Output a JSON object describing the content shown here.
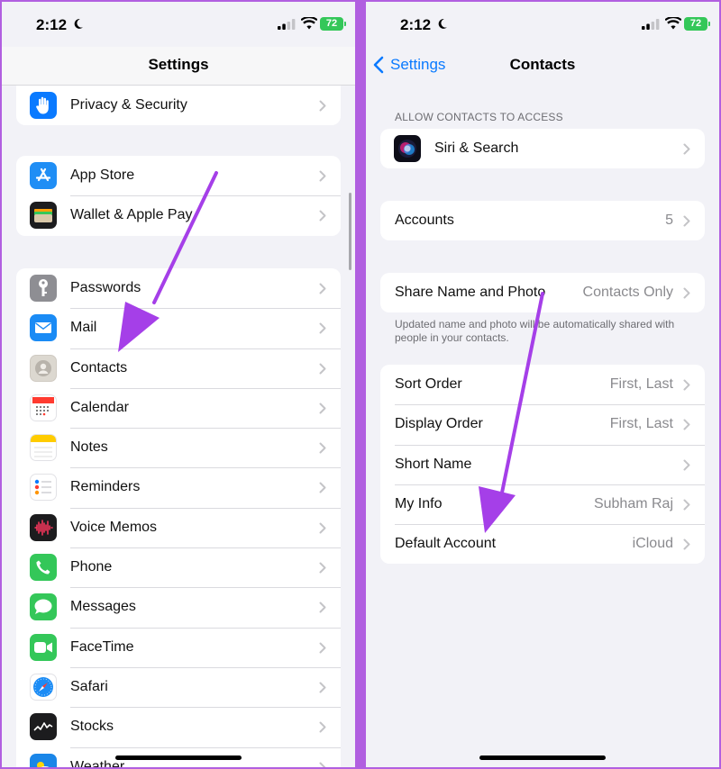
{
  "left": {
    "status": {
      "time": "2:12",
      "battery": "72"
    },
    "nav": {
      "title": "Settings"
    },
    "groups": [
      {
        "items": [
          {
            "label": "Privacy & Security",
            "icon": "hand-icon"
          }
        ]
      },
      {
        "items": [
          {
            "label": "App Store",
            "icon": "app-store-icon"
          },
          {
            "label": "Wallet & Apple Pay",
            "icon": "wallet-icon"
          }
        ]
      },
      {
        "items": [
          {
            "label": "Passwords",
            "icon": "key-icon"
          },
          {
            "label": "Mail",
            "icon": "mail-icon"
          },
          {
            "label": "Contacts",
            "icon": "contacts-icon"
          },
          {
            "label": "Calendar",
            "icon": "calendar-icon"
          },
          {
            "label": "Notes",
            "icon": "notes-icon"
          },
          {
            "label": "Reminders",
            "icon": "reminders-icon"
          },
          {
            "label": "Voice Memos",
            "icon": "voice-memos-icon"
          },
          {
            "label": "Phone",
            "icon": "phone-icon"
          },
          {
            "label": "Messages",
            "icon": "messages-icon"
          },
          {
            "label": "FaceTime",
            "icon": "facetime-icon"
          },
          {
            "label": "Safari",
            "icon": "safari-icon"
          },
          {
            "label": "Stocks",
            "icon": "stocks-icon"
          },
          {
            "label": "Weather",
            "icon": "weather-icon"
          }
        ]
      }
    ]
  },
  "right": {
    "status": {
      "time": "2:12",
      "battery": "72"
    },
    "nav": {
      "back_label": "Settings",
      "title": "Contacts"
    },
    "allow_header": "ALLOW CONTACTS TO ACCESS",
    "siri": {
      "label": "Siri & Search",
      "icon": "siri-icon"
    },
    "accounts": {
      "label": "Accounts",
      "value": "5"
    },
    "share": {
      "label": "Share Name and Photo",
      "value": "Contacts Only",
      "footer": "Updated name and photo will be automatically shared with people in your contacts."
    },
    "prefs": [
      {
        "label": "Sort Order",
        "value": "First, Last"
      },
      {
        "label": "Display Order",
        "value": "First, Last"
      },
      {
        "label": "Short Name",
        "value": ""
      },
      {
        "label": "My Info",
        "value": "Subham Raj"
      },
      {
        "label": "Default Account",
        "value": "iCloud"
      }
    ]
  },
  "colors": {
    "accent": "#0a7aff",
    "annotation_arrow": "#a53fe8",
    "frame": "#b15fe0"
  }
}
